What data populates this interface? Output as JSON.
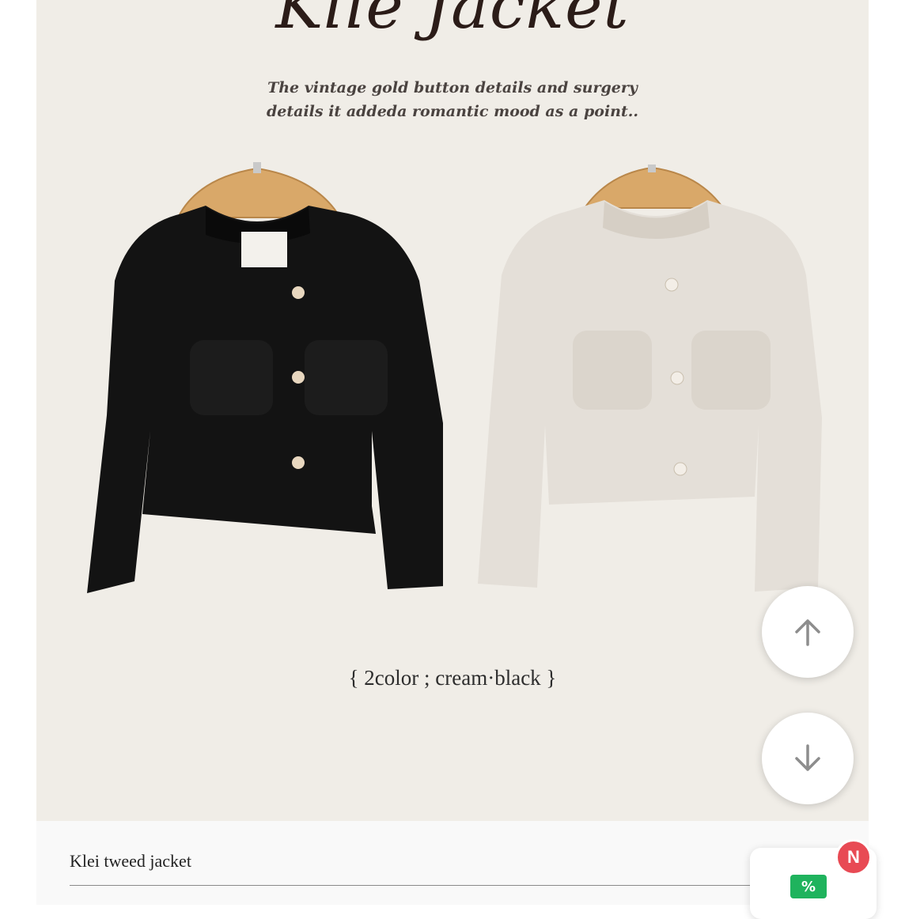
{
  "page": {
    "title": "Klie Jacket",
    "subtitle_lines": [
      "The vintage gold button details and surgery",
      "details it addeda romantic mood as a point.."
    ],
    "colors_caption": "{ 2color ; cream·black }"
  },
  "product_images": [
    {
      "name": "black",
      "jacket_color": "#131313",
      "button_color": "#e8d7bf"
    },
    {
      "name": "cream",
      "jacket_color": "#e4dfd8",
      "button_color": "#f3eee7"
    }
  ],
  "product_name": "Klei tweed jacket",
  "floating": {
    "scroll_up_icon": "arrow-up-icon",
    "scroll_down_icon": "arrow-down-icon",
    "badge_letter": "N",
    "coupon_icon": "coupon-percent-icon",
    "coupon_symbol": "%"
  },
  "theme": {
    "background": "#f0ede7",
    "title_color": "#2b1c18",
    "badge_color": "#e84a54",
    "coupon_color": "#1fb35d"
  }
}
